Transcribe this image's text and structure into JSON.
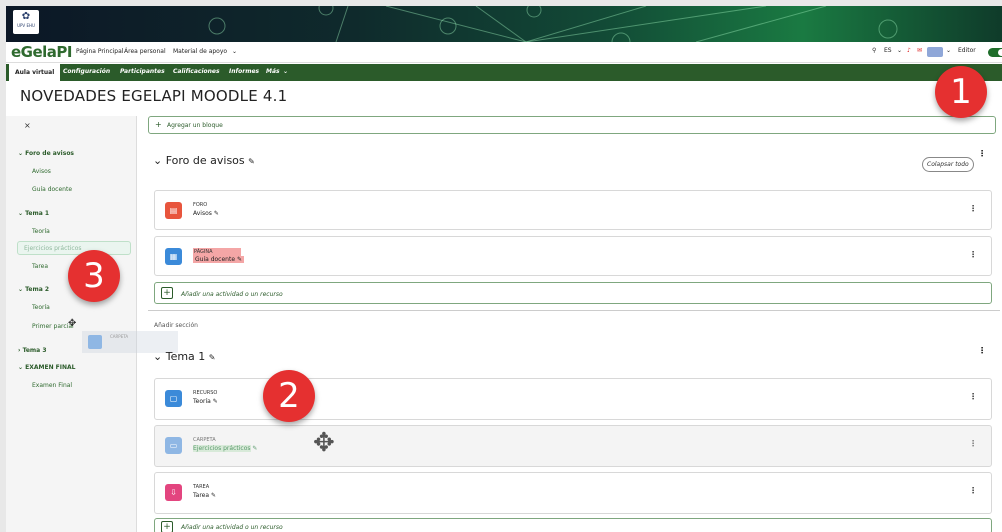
{
  "banner": {
    "logo_text": "UPV EHU"
  },
  "nav": {
    "brand": "eGelaPI",
    "links": [
      "Página Principal",
      "Área personal",
      "Material de apoyo"
    ],
    "lang": "ES",
    "editor_label": "Editor"
  },
  "tabs": [
    "Aula virtual",
    "Configuración",
    "Participantes",
    "Calificaciones",
    "Informes",
    "Más"
  ],
  "page_title": "NOVEDADES EGELAPI MOODLE 4.1",
  "sidebar": {
    "close": "×",
    "items": [
      {
        "label": "Foro de avisos",
        "type": "section"
      },
      {
        "label": "Avisos",
        "type": "item"
      },
      {
        "label": "Guía docente",
        "type": "item"
      },
      {
        "label": "Tema 1",
        "type": "section"
      },
      {
        "label": "Teoría",
        "type": "item"
      },
      {
        "label": "Ejercicios prácticos",
        "type": "item"
      },
      {
        "label": "Tarea",
        "type": "item"
      },
      {
        "label": "Tema 2",
        "type": "section"
      },
      {
        "label": "Teoría",
        "type": "item"
      },
      {
        "label": "Primer parcial",
        "type": "item"
      },
      {
        "label": "Tema 3",
        "type": "section"
      },
      {
        "label": "EXAMEN FINAL",
        "type": "section"
      },
      {
        "label": "Examen Final",
        "type": "item"
      }
    ]
  },
  "main": {
    "add_block": "Agregar un bloque",
    "collapse_all": "Colapsar todo",
    "add_activity": "Añadir una actividad o un recurso",
    "add_section": "Añadir sección",
    "sections": [
      {
        "title": "Foro de avisos",
        "activities": [
          {
            "type": "FORO",
            "name": "Avisos",
            "color": "#e8553d"
          },
          {
            "type": "PÁGINA",
            "name": "Guía docente",
            "color": "#3b8ad9"
          }
        ]
      },
      {
        "title": "Tema 1",
        "activities": [
          {
            "type": "RECURSO",
            "name": "Teoría",
            "color": "#3b8ad9"
          },
          {
            "type": "CARPETA",
            "name": "Ejercicios prácticos",
            "color": "#3b8ad9"
          },
          {
            "type": "TAREA",
            "name": "Tarea",
            "color": "#e3457f"
          }
        ]
      }
    ],
    "ghost_type": "CARPETA"
  },
  "badges": [
    "1",
    "2",
    "3"
  ]
}
